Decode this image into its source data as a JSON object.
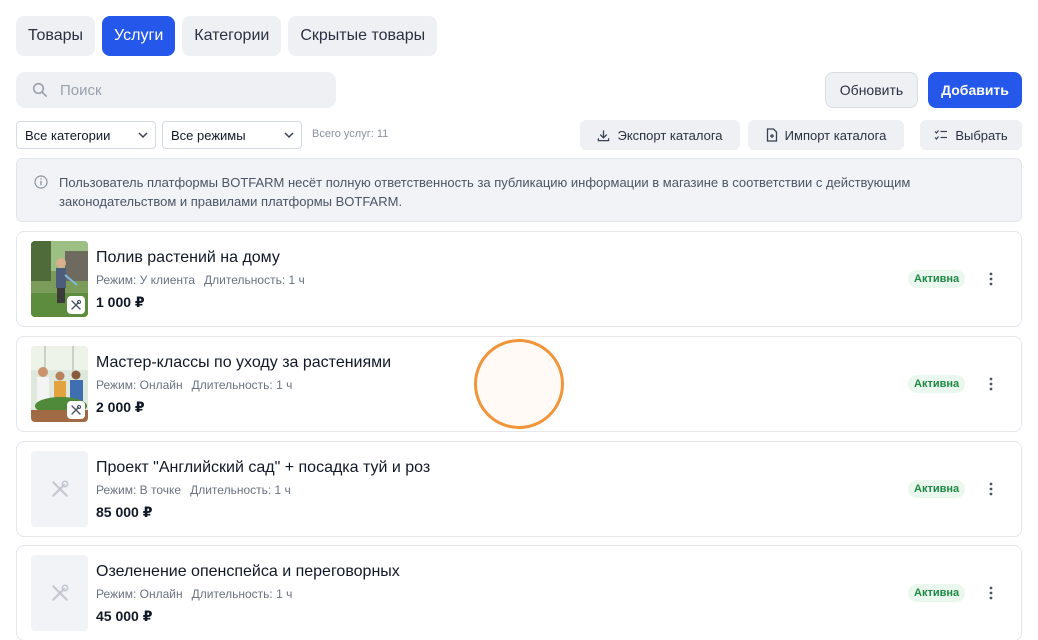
{
  "tabs": [
    {
      "label": "Товары",
      "active": false
    },
    {
      "label": "Услуги",
      "active": true
    },
    {
      "label": "Категории",
      "active": false
    },
    {
      "label": "Скрытые товары",
      "active": false
    }
  ],
  "search": {
    "placeholder": "Поиск",
    "value": ""
  },
  "toolbar": {
    "refresh_label": "Обновить",
    "add_label": "Добавить"
  },
  "filters": {
    "category": "Все категории",
    "mode": "Все режимы",
    "total": "Всего услуг: 11",
    "export_label": "Экспорт каталога",
    "import_label": "Импорт каталога",
    "select_label": "Выбрать"
  },
  "notice": {
    "text": "Пользователь платформы BOTFARM несёт полную ответственность за публикацию информации в магазине в соответствии с действующим законодательством и правилами платформы BOTFARM."
  },
  "services": [
    {
      "title": "Полив растений на дому",
      "mode": "Режим: У клиента",
      "duration": "Длительность: 1 ч",
      "price": "1 000 ₽",
      "status": "Активна"
    },
    {
      "title": "Мастер-классы по уходу за растениями",
      "mode": "Режим: Онлайн",
      "duration": "Длительность: 1 ч",
      "price": "2 000 ₽",
      "status": "Активна"
    },
    {
      "title": "Проект \"Английский сад\" + посадка туй и роз",
      "mode": "Режим: В точке",
      "duration": "Длительность: 1 ч",
      "price": "85 000 ₽",
      "status": "Активна"
    },
    {
      "title": "Озеленение опенспейса и переговорных",
      "mode": "Режим: Онлайн",
      "duration": "Длительность: 1 ч",
      "price": "45 000 ₽",
      "status": "Активна"
    }
  ],
  "colors": {
    "accent": "#2457ea",
    "status_active_text": "#1f8a46",
    "status_active_bg": "#eaf7ee",
    "cursor_ring": "#f0953a"
  },
  "icons": {
    "search": "search-icon",
    "export": "download-icon",
    "import": "file-icon",
    "select": "checklist-icon",
    "service": "tools-icon",
    "menu": "kebab-icon",
    "info": "info-icon"
  }
}
